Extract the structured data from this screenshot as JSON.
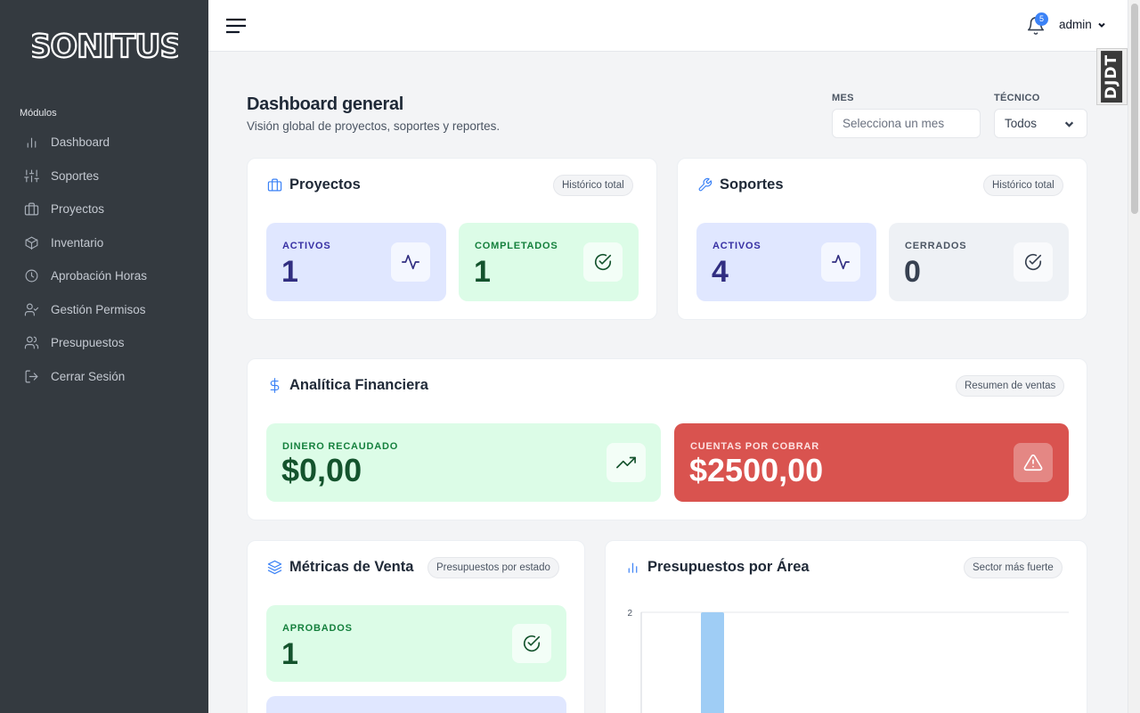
{
  "brand": {
    "logo_text": "SONITUS"
  },
  "sidebar": {
    "section_label": "Módulos",
    "items": [
      {
        "label": "Dashboard",
        "icon": "bar-chart-icon"
      },
      {
        "label": "Soportes",
        "icon": "sliders-icon"
      },
      {
        "label": "Proyectos",
        "icon": "briefcase-icon"
      },
      {
        "label": "Inventario",
        "icon": "box-icon"
      },
      {
        "label": "Aprobación Horas",
        "icon": "clock-icon"
      },
      {
        "label": "Gestión Permisos",
        "icon": "user-check-icon"
      },
      {
        "label": "Presupuestos",
        "icon": "users-icon"
      },
      {
        "label": "Cerrar Sesión",
        "icon": "logout-icon"
      }
    ]
  },
  "topbar": {
    "notification_count": "5",
    "username": "admin"
  },
  "debug_toolbar": {
    "label": "DJDT"
  },
  "header": {
    "title": "Dashboard general",
    "subtitle": "Visión global de proyectos, soportes y reportes.",
    "filters": {
      "month": {
        "label": "MES",
        "placeholder": "Selecciona un mes"
      },
      "technician": {
        "label": "TÉCNICO",
        "value": "Todos"
      }
    }
  },
  "proyectos": {
    "title": "Proyectos",
    "pill": "Histórico total",
    "stats": [
      {
        "label": "ACTIVOS",
        "value": "1"
      },
      {
        "label": "COMPLETADOS",
        "value": "1"
      }
    ]
  },
  "soportes": {
    "title": "Soportes",
    "pill": "Histórico total",
    "stats": [
      {
        "label": "ACTIVOS",
        "value": "4"
      },
      {
        "label": "CERRADOS",
        "value": "0"
      }
    ]
  },
  "finanzas": {
    "title": "Analítica Financiera",
    "pill": "Resumen de ventas",
    "stats": [
      {
        "label": "DINERO RECAUDADO",
        "value": "$0,00"
      },
      {
        "label": "CUENTAS POR COBRAR",
        "value": "$2500,00"
      }
    ]
  },
  "metricas": {
    "title": "Métricas de Venta",
    "pill": "Presupuestos por estado",
    "stats": [
      {
        "label": "APROBADOS",
        "value": "1"
      }
    ]
  },
  "presupuestos_area": {
    "title": "Presupuestos por Área",
    "pill": "Sector más fuerte"
  },
  "chart_data": {
    "type": "bar",
    "y_tick_labels": [
      "2"
    ],
    "ylim_visible_top": 2,
    "values": [
      2
    ],
    "bar_color": "#9fcdf5"
  },
  "colors": {
    "sidebar_bg": "#343a40",
    "accent": "#3b82f6",
    "danger": "#d9534f"
  }
}
